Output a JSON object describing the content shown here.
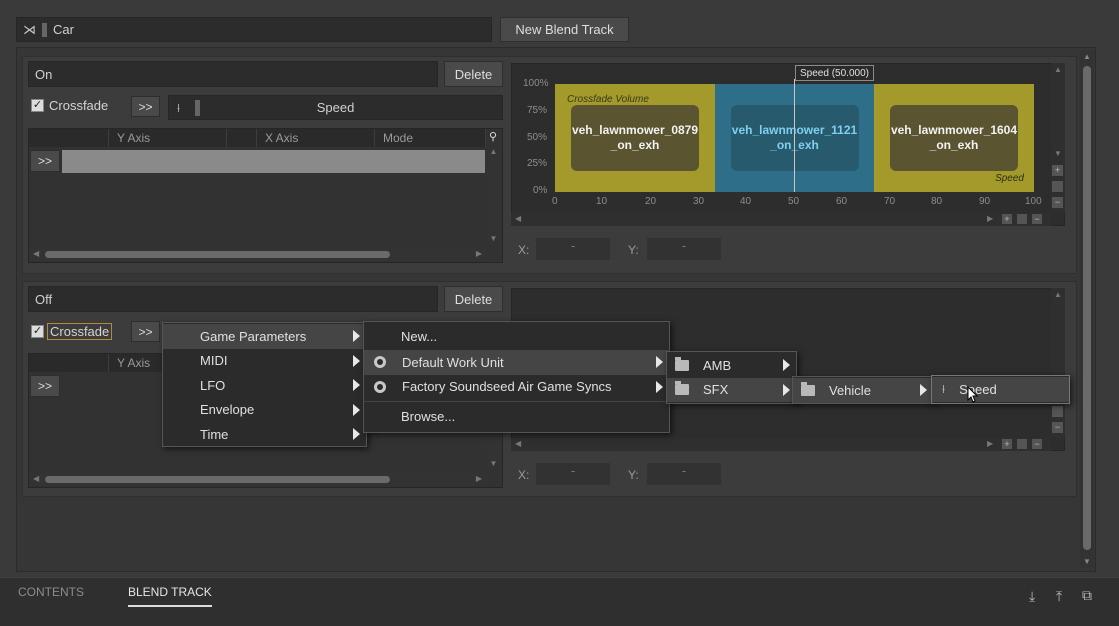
{
  "top": {
    "name_value": "Car",
    "new_blend_track_label": "New Blend Track"
  },
  "track1": {
    "name": "On",
    "delete_label": "Delete",
    "crossfade_label": "Crossfade",
    "expand_label": ">>",
    "param_label": "Speed",
    "columns": [
      "Y Axis",
      "X Axis",
      "Mode"
    ],
    "row_expand_label": ">>",
    "graph": {
      "tooltip": "Speed (50.000)",
      "crossfade_label": "Crossfade Volume",
      "speed_tag": "Speed",
      "y_ticks": [
        "100%",
        "75%",
        "50%",
        "25%",
        "0%"
      ],
      "x_ticks": [
        "0",
        "10",
        "20",
        "30",
        "40",
        "50",
        "60",
        "70",
        "80",
        "90",
        "100"
      ],
      "segments": [
        {
          "label": "veh_lawnmower_0879_on_exh",
          "line1": "veh_lawnmower_0879",
          "line2": "_on_exh",
          "color": "#a39a2b"
        },
        {
          "label": "veh_lawnmower_1121_on_exh",
          "line1": "veh_lawnmower_1121",
          "line2": "_on_exh",
          "color": "#2f6e88"
        },
        {
          "label": "veh_lawnmower_1604_on_exh",
          "line1": "veh_lawnmower_1604",
          "line2": "_on_exh",
          "color": "#a39a2b"
        }
      ]
    },
    "x_label": "X:",
    "x_value": "-",
    "y_label": "Y:",
    "y_value": "-"
  },
  "track2": {
    "name": "Off",
    "delete_label": "Delete",
    "crossfade_label": "Crossfade",
    "expand_label": ">>",
    "columns": [
      "Y Axis"
    ],
    "row_expand_label": ">>",
    "x_label": "X:",
    "x_value": "-",
    "y_label": "Y:",
    "y_value": "-"
  },
  "context_menu": {
    "level1": [
      "Game Parameters",
      "MIDI",
      "LFO",
      "Envelope",
      "Time"
    ],
    "level2": [
      "New...",
      "Default Work Unit",
      "Factory Soundseed Air Game Syncs",
      "Browse..."
    ],
    "level3": [
      "AMB",
      "SFX"
    ],
    "level4": [
      "Vehicle"
    ],
    "level5": [
      "Speed"
    ]
  },
  "bottom_tabs": [
    "CONTENTS",
    "BLEND TRACK"
  ],
  "active_tab": "BLEND TRACK",
  "colors": {
    "yellow_segment": "#a39a2b",
    "blue_segment": "#2f6e88",
    "background": "#3a3a3a"
  }
}
